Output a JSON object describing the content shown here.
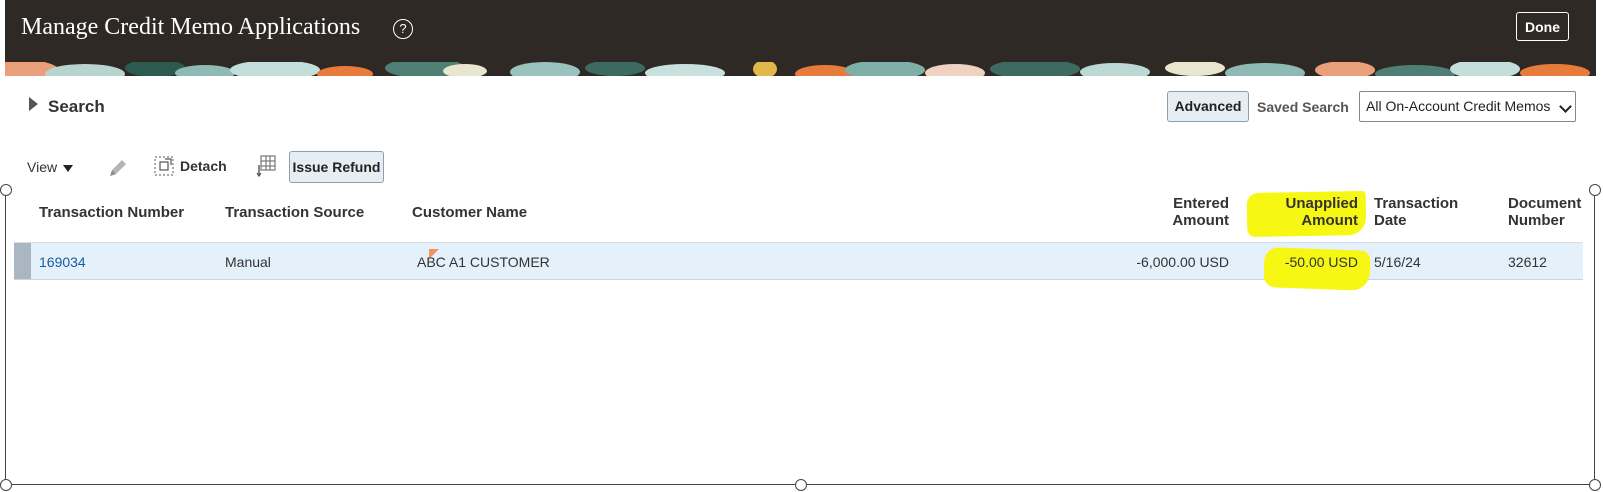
{
  "header": {
    "title": "Manage Credit Memo Applications",
    "help_icon": "question-circle-icon",
    "done_label": "Done"
  },
  "search": {
    "label": "Search",
    "advanced_label": "Advanced",
    "saved_search_label": "Saved Search",
    "saved_search_value": "All On-Account Credit Memos"
  },
  "toolbar": {
    "view_label": "View",
    "edit_icon": "pencil-icon",
    "detach_icon": "detach-icon",
    "detach_label": "Detach",
    "freeze_icon": "freeze-columns-icon",
    "issue_refund_label": "Issue Refund"
  },
  "table": {
    "columns": [
      {
        "line1": "Transaction Number",
        "line2": ""
      },
      {
        "line1": "Transaction Source",
        "line2": ""
      },
      {
        "line1": "Customer Name",
        "line2": ""
      },
      {
        "line1": "Entered",
        "line2": "Amount"
      },
      {
        "line1": "Unapplied",
        "line2": "Amount"
      },
      {
        "line1": "Transaction",
        "line2": "Date"
      },
      {
        "line1": "Document",
        "line2": "Number"
      }
    ],
    "rows": [
      {
        "transaction_number": "169034",
        "transaction_source": "Manual",
        "customer_name": "ABC A1 CUSTOMER",
        "entered_amount": "-6,000.00 USD",
        "unapplied_amount": "-50.00 USD",
        "transaction_date": "5/16/24",
        "document_number": "32612"
      }
    ]
  },
  "colors": {
    "header_bg": "#2e2925",
    "highlight": "#f7f714",
    "selected_row": "#e4f0fa",
    "link": "#145c9e"
  }
}
